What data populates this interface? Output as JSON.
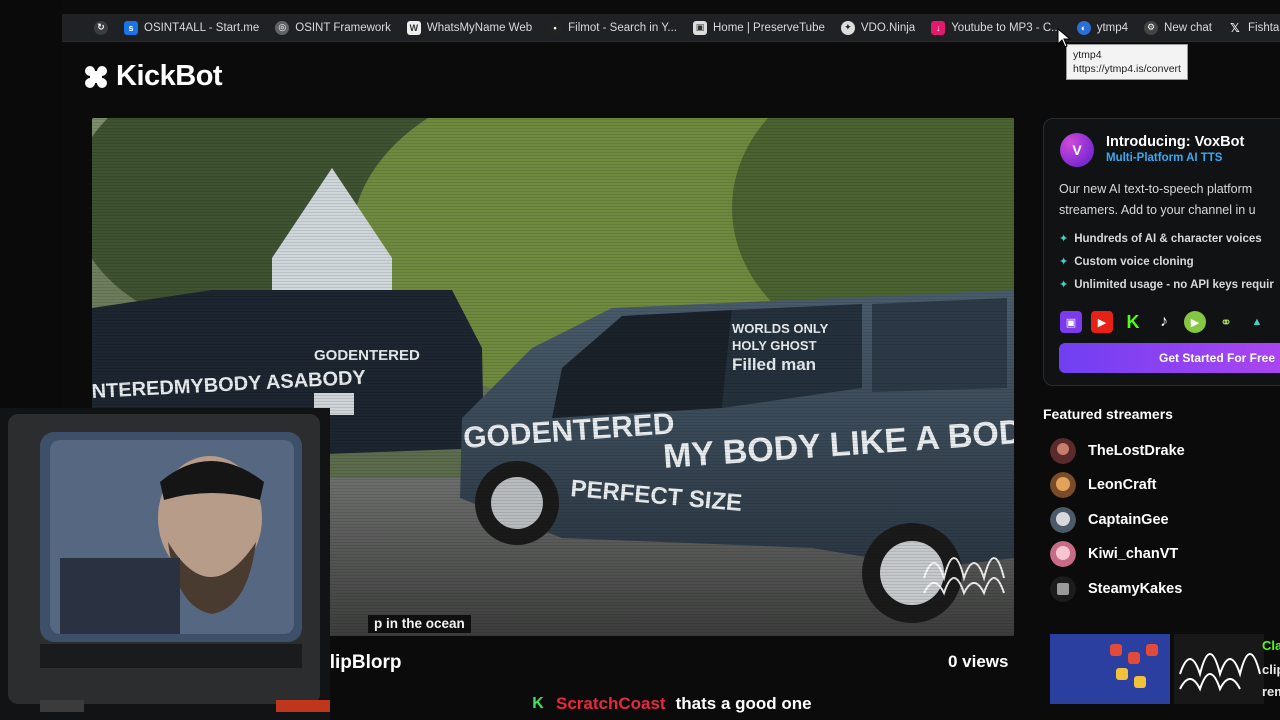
{
  "bookmarks": [
    {
      "label": "OSINT4ALL - Start.me",
      "icon": "startme-icon",
      "color": "#1a73e8"
    },
    {
      "label": "OSINT Framework",
      "icon": "globe-icon",
      "color": "#8a8f96"
    },
    {
      "label": "WhatsMyName Web",
      "icon": "whatsmyname-icon",
      "color": "#ffffff"
    },
    {
      "label": "Filmot - Search in Y...",
      "icon": "filmot-icon",
      "color": "#333333"
    },
    {
      "label": "Home | PreserveTube",
      "icon": "preservetube-icon",
      "color": "#cccccc"
    },
    {
      "label": "VDO.Ninja",
      "icon": "vdoninja-icon",
      "color": "#dddddd"
    },
    {
      "label": "Youtube to MP3 - C...",
      "icon": "download-icon",
      "color": "#e4186c"
    },
    {
      "label": "ytmp4",
      "icon": "ytmp4-icon",
      "color": "#2a6fd6"
    },
    {
      "label": "New chat",
      "icon": "chatgpt-icon",
      "color": "#bbbbbb"
    },
    {
      "label": "Fishtank",
      "icon": "x-icon",
      "color": "#ffffff"
    }
  ],
  "tooltip": {
    "title": "ytmp4",
    "url": "https://ytmp4.is/convert"
  },
  "logo": {
    "text": "KickBot"
  },
  "video": {
    "caption": "p in the ocean"
  },
  "clip": {
    "title": "BlipBlorp",
    "views": "0 views"
  },
  "chat": {
    "username": "ScratchCoast",
    "message": "thats a good one"
  },
  "voxbot": {
    "title": "Introducing: VoxBot",
    "subtitle": "Multi-Platform AI TTS",
    "description_line1": "Our new AI text-to-speech platform",
    "description_line2": "streamers. Add to your channel in u",
    "features": [
      "Hundreds of AI & character voices",
      "Custom voice cloning",
      "Unlimited usage - no API keys requir"
    ],
    "cta": "Get Started For Free",
    "accent": "#38a9f2"
  },
  "featured": {
    "title": "Featured streamers",
    "streamers": [
      {
        "name": "TheLostDrake"
      },
      {
        "name": "LeonCraft"
      },
      {
        "name": "CaptainGee"
      },
      {
        "name": "Kiwi_chanVT"
      },
      {
        "name": "SteamyKakes"
      }
    ]
  },
  "edge_texts": [
    "Cla",
    "clip",
    "rem"
  ],
  "colors": {
    "kick_green": "#53fc18",
    "chat_user": "#e8283f",
    "cta_start": "#6f3ff2",
    "cta_end": "#b046f0"
  }
}
